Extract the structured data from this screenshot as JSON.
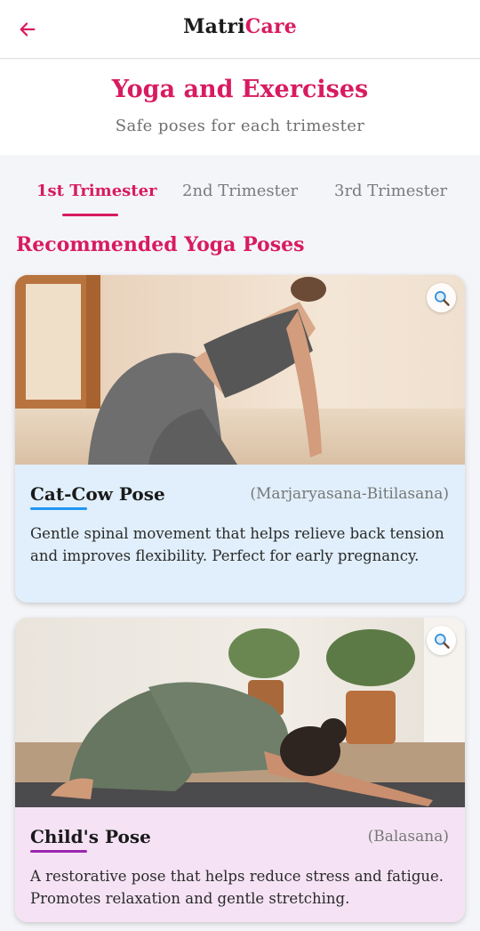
{
  "app": {
    "brand_part1": "Matri",
    "brand_part2": "Care",
    "back_icon": "arrow-left-icon"
  },
  "hero": {
    "title": "Yoga and Exercises",
    "subtitle": "Safe poses for each trimester"
  },
  "tabs": [
    {
      "label": "1st Trimester",
      "active": true
    },
    {
      "label": "2nd Trimester",
      "active": false
    },
    {
      "label": "3rd Trimester",
      "active": false
    }
  ],
  "section": {
    "title": "Recommended Yoga Poses"
  },
  "poses": [
    {
      "name": "Cat-Cow Pose",
      "sanskrit": "(Marjaryasana-Bitilasana)",
      "description": "Gentle spinal movement that helps relieve back tension and improves flexibility. Perfect for early pregnancy.",
      "card_bg": "#e0effb",
      "accent": "#2196f3",
      "zoom_icon": "magnifier-icon"
    },
    {
      "name": "Child's Pose",
      "sanskrit": "(Balasana)",
      "description": "A restorative pose that helps reduce stress and fatigue. Promotes relaxation and gentle stretching.",
      "card_bg": "#f5e3f5",
      "accent": "#9c27b0",
      "zoom_icon": "magnifier-icon"
    }
  ],
  "colors": {
    "brand": "#d81b60",
    "page_bg": "#f4f5f8"
  }
}
